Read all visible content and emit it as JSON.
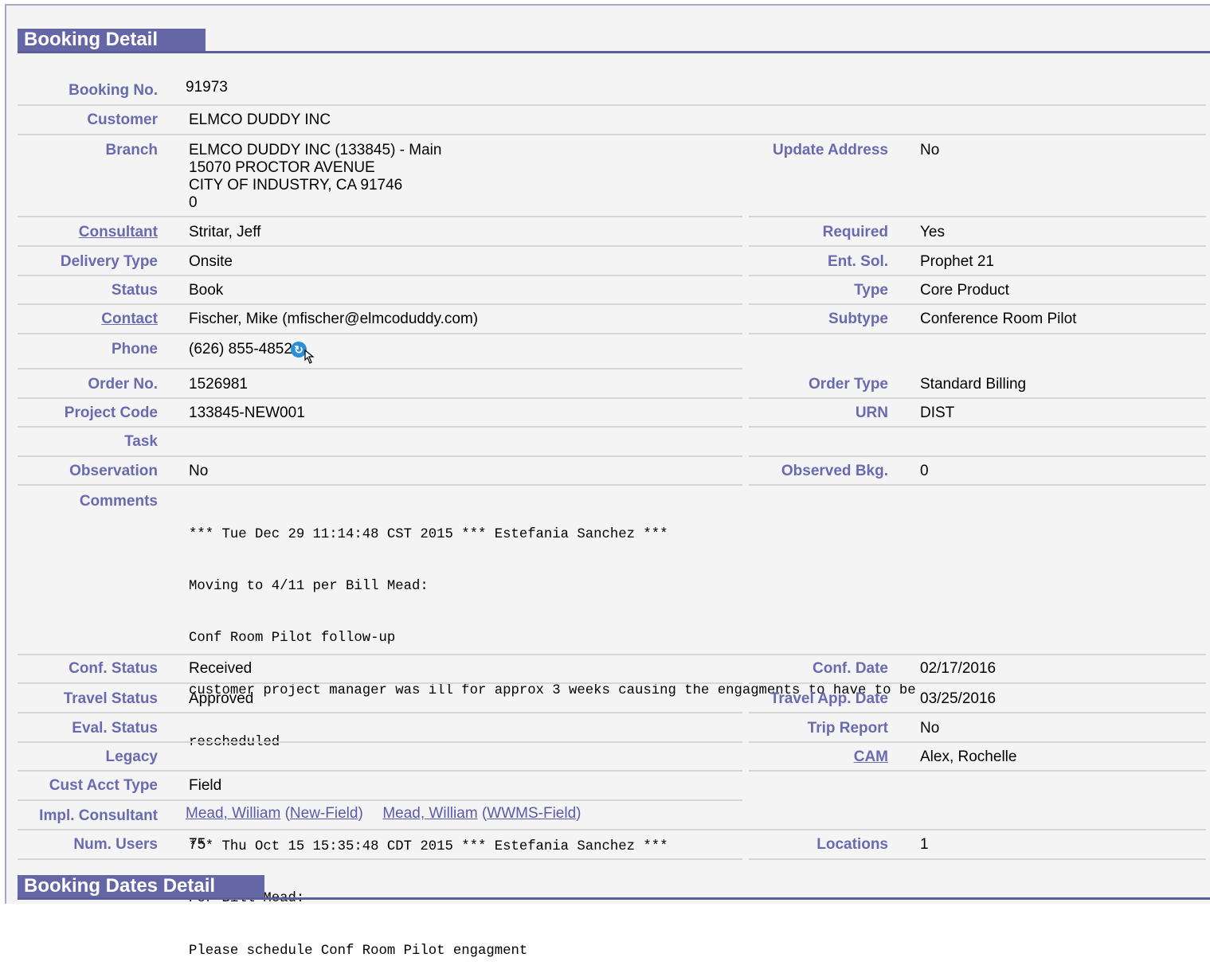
{
  "sections": {
    "booking_detail": "Booking Detail",
    "booking_dates_detail": "Booking Dates Detail"
  },
  "fields": {
    "booking_no": {
      "label": "Booking No.",
      "value": "91973"
    },
    "customer": {
      "label": "Customer",
      "value": "ELMCO DUDDY INC"
    },
    "branch": {
      "label": "Branch",
      "lines": [
        "ELMCO DUDDY INC (133845) - Main",
        "15070 PROCTOR AVENUE",
        "CITY OF INDUSTRY, CA  91746",
        "0"
      ]
    },
    "update_address": {
      "label": "Update Address",
      "value": "No"
    },
    "consultant": {
      "label": "Consultant",
      "value": "Stritar, Jeff"
    },
    "required": {
      "label": "Required",
      "value": "Yes"
    },
    "delivery_type": {
      "label": "Delivery Type",
      "value": "Onsite"
    },
    "ent_sol": {
      "label": "Ent. Sol.",
      "value": "Prophet 21"
    },
    "status": {
      "label": "Status",
      "value": "Book"
    },
    "type": {
      "label": "Type",
      "value": "Core Product"
    },
    "contact": {
      "label": "Contact",
      "value": "Fischer, Mike (mfischer@elmcoduddy.com)"
    },
    "subtype": {
      "label": "Subtype",
      "value": "Conference Room Pilot"
    },
    "phone": {
      "label": "Phone",
      "value": "(626) 855-4852"
    },
    "order_no": {
      "label": "Order No.",
      "value": "1526981"
    },
    "order_type": {
      "label": "Order Type",
      "value": "Standard Billing"
    },
    "project_code": {
      "label": "Project Code",
      "value": "133845-NEW001"
    },
    "urn": {
      "label": "URN",
      "value": "DIST"
    },
    "task": {
      "label": "Task",
      "value": ""
    },
    "observation": {
      "label": "Observation",
      "value": "No"
    },
    "observed_bkg": {
      "label": "Observed Bkg.",
      "value": "0"
    },
    "comments": {
      "label": "Comments",
      "lines": [
        "*** Tue Dec 29 11:14:48 CST 2015 *** Estefania Sanchez ***",
        "Moving to 4/11 per Bill Mead:",
        "Conf Room Pilot follow-up",
        "customer project manager was ill for approx 3 weeks causing the engagments to have to be",
        "rescheduled",
        "",
        "*** Thu Oct 15 15:35:48 CDT 2015 *** Estefania Sanchez ***",
        "Per Bill Mead:",
        "Please schedule Conf Room Pilot engagment"
      ]
    },
    "conf_status": {
      "label": "Conf. Status",
      "value": "Received"
    },
    "conf_date": {
      "label": "Conf. Date",
      "value": "02/17/2016"
    },
    "travel_status": {
      "label": "Travel Status",
      "value": "Approved"
    },
    "travel_app_date": {
      "label": "Travel App. Date",
      "value": "03/25/2016"
    },
    "eval_status": {
      "label": "Eval. Status",
      "value": ""
    },
    "trip_report": {
      "label": "Trip Report",
      "value": "No"
    },
    "legacy": {
      "label": "Legacy",
      "value": ""
    },
    "cam": {
      "label": "CAM",
      "value": "Alex, Rochelle"
    },
    "cust_acct_type": {
      "label": "Cust Acct Type",
      "value": "Field"
    },
    "impl_consultant": {
      "label": "Impl. Consultant",
      "items": [
        {
          "name": "Mead, William",
          "role": "New-Field"
        },
        {
          "name": "Mead, William",
          "role": "WWMS-Field"
        }
      ],
      "paren_open": "(",
      "paren_close": ")"
    },
    "num_users": {
      "label": "Num. Users",
      "value": "75"
    },
    "locations": {
      "label": "Locations",
      "value": "1"
    }
  },
  "icons": {
    "phone_dial": "phone-dial-icon",
    "cursor": "hand-cursor-icon"
  },
  "colors": {
    "header_bg": "#6566a6",
    "label_text": "#6a6ab0",
    "link_text": "#5a5aa8",
    "panel_bg": "#f4f4f4",
    "phone_icon": "#2a8ed8"
  }
}
